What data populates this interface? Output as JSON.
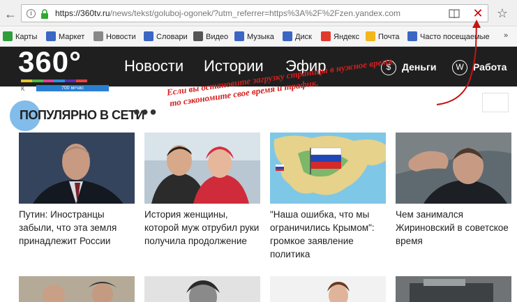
{
  "browser": {
    "url_host": "https://360tv.ru",
    "url_path": "/news/tekst/goluboj-ogonek/?utm_referrer=https%3A%2F%2Fzen.yandex.com"
  },
  "bookmarks": [
    {
      "label": "Карты",
      "color": "#2e9e3b"
    },
    {
      "label": "Маркет",
      "color": "#3b66c4"
    },
    {
      "label": "Новости",
      "color": "#888888"
    },
    {
      "label": "Словари",
      "color": "#3b66c4"
    },
    {
      "label": "Видео",
      "color": "#555555"
    },
    {
      "label": "Музыка",
      "color": "#3b66c4"
    },
    {
      "label": "Диск",
      "color": "#3b66c4"
    },
    {
      "label": "Яндекс",
      "color": "#e23b2b"
    },
    {
      "label": "Почта",
      "color": "#f3b61b"
    },
    {
      "label": "Часто посещаемые",
      "color": "#3b66c4"
    }
  ],
  "bookmarks_more": "»",
  "site": {
    "logo": "360°",
    "logo_stripe_colors": [
      "#e8c52a",
      "#52b948",
      "#e23d97",
      "#2d8ee0",
      "#5a2bb5",
      "#e84141"
    ],
    "nav": [
      "Новости",
      "Истории",
      "Эфир"
    ],
    "money_label": "Деньги",
    "money_icon": "$",
    "work_label": "Работа",
    "work_icon": "W",
    "strip_k": "К",
    "strip_ad": "700 мгчас"
  },
  "section": {
    "title": "ПОПУЛЯРНО В СЕТИ",
    "more": "•••"
  },
  "cards": [
    {
      "caption": "Путин: Иностранцы забыли, что эта земля принадлежит России"
    },
    {
      "caption": "История женщины, которой муж отрубил руки получила продолжение"
    },
    {
      "caption": "\"Наша ошибка, что мы ограничились Крымом\": громкое заявление политика"
    },
    {
      "caption": "Чем занимался Жириновский в советское время"
    }
  ],
  "annotation": {
    "line1": "Если вы остановите загрузку страницы в нужное время,",
    "line2": "то сэкономите свое время и трафик."
  },
  "colors": {
    "accent_red": "#d41f1f",
    "header_bg": "#1f1f1f"
  }
}
